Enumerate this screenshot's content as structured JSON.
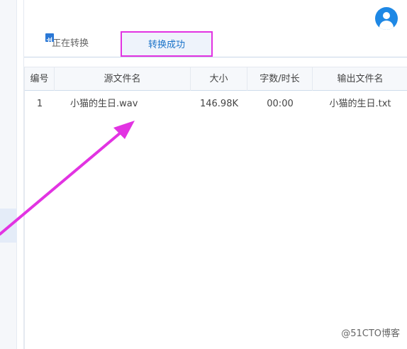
{
  "tabs": [
    {
      "label": "正在转换",
      "active": false
    },
    {
      "label": "转换成功",
      "active": true
    }
  ],
  "table": {
    "headers": [
      "编号",
      "源文件名",
      "大小",
      "字数/时长",
      "输出文件名"
    ],
    "rows": [
      {
        "index": "1",
        "source": "小猫的生日.wav",
        "size": "146.98K",
        "duration": "00:00",
        "output": "小猫的生日.txt"
      }
    ]
  },
  "watermark": "@51CTO博客",
  "colors": {
    "accent": "#1e88e5",
    "highlight": "#e233e2",
    "tab_active_text": "#1a73c9"
  },
  "icons": {
    "avatar": "user-avatar-icon",
    "file": "audio-file-icon"
  }
}
